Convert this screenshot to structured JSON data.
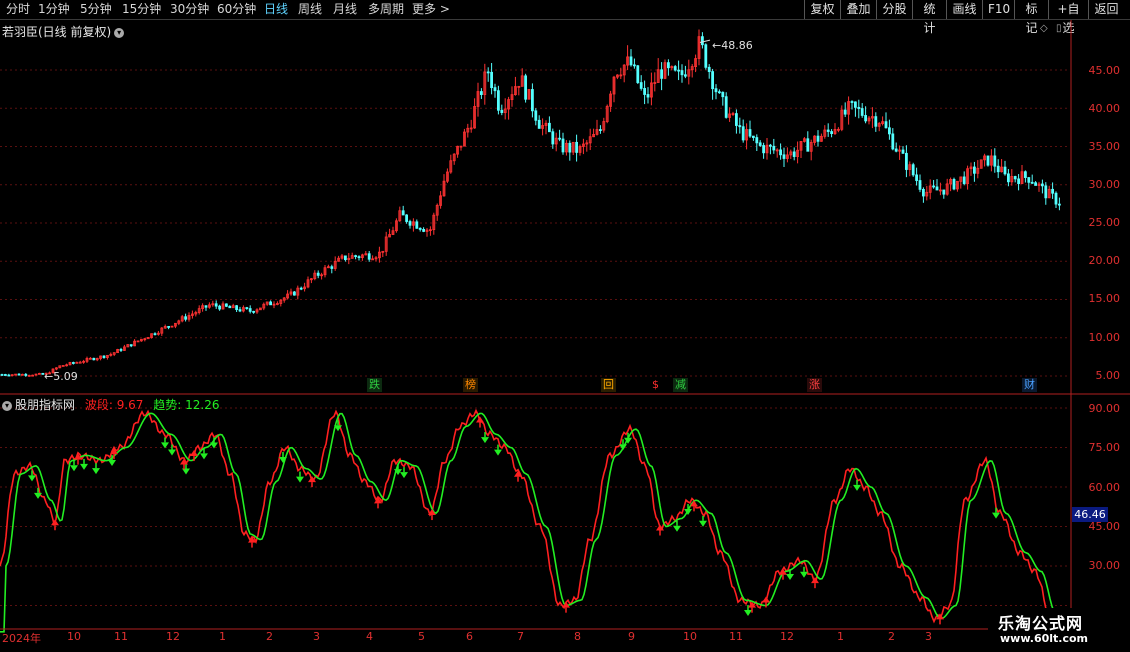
{
  "toolbar": {
    "periods": [
      "分时",
      "1分钟",
      "5分钟",
      "15分钟",
      "30分钟",
      "60分钟",
      "日线",
      "周线",
      "月线",
      "多周期",
      "更多 >"
    ],
    "active_period": "日线",
    "right_buttons": [
      "复权",
      "叠加",
      "分股",
      "统计",
      "画线",
      "F10",
      "标记",
      "+自选",
      "返回"
    ]
  },
  "main_panel": {
    "title": "若羽臣(日线 前复权)",
    "high_label": "48.86",
    "low_label": "5.09",
    "y_ticks": [
      "45.00",
      "40.00",
      "35.00",
      "30.00",
      "25.00",
      "20.00",
      "15.00",
      "10.00",
      "5.00"
    ],
    "events": [
      {
        "text": "跌",
        "color": "#2ecc40",
        "bg": "#0c2a10"
      },
      {
        "text": "榜",
        "color": "#ff8800",
        "bg": "#2a1a00"
      },
      {
        "text": "回",
        "color": "#ffaa00",
        "bg": "#2a1e00"
      },
      {
        "text": "$",
        "color": "#ff3030",
        "bg": "#000000"
      },
      {
        "text": "减",
        "color": "#2ecc40",
        "bg": "#0c2a10"
      },
      {
        "text": "涨",
        "color": "#ff4040",
        "bg": "#2a0a0a"
      },
      {
        "text": "财",
        "color": "#4aa0ff",
        "bg": "#0a1a30"
      }
    ]
  },
  "sub_panel": {
    "title": "股朋指标网",
    "series1_label": "波段: 9.67",
    "series2_label": "趋势: 12.26",
    "series1_color": "#ff2020",
    "series2_color": "#22ee22",
    "y_ticks": [
      "90.00",
      "75.00",
      "60.00",
      "45.00",
      "30.00"
    ],
    "current_value": "46.46"
  },
  "x_axis": {
    "labels": [
      "2024年",
      "10",
      "11",
      "12",
      "1",
      "2",
      "3",
      "4",
      "5",
      "6",
      "7",
      "8",
      "9",
      "10",
      "11",
      "12",
      "1",
      "2",
      "3"
    ]
  },
  "watermark": {
    "line1": "乐淘公式网",
    "line2": "www.60lt.com"
  },
  "colors": {
    "up": "#ff3232",
    "down": "#54ffff",
    "grid": "#5a1010",
    "axis": "#b02020"
  }
}
